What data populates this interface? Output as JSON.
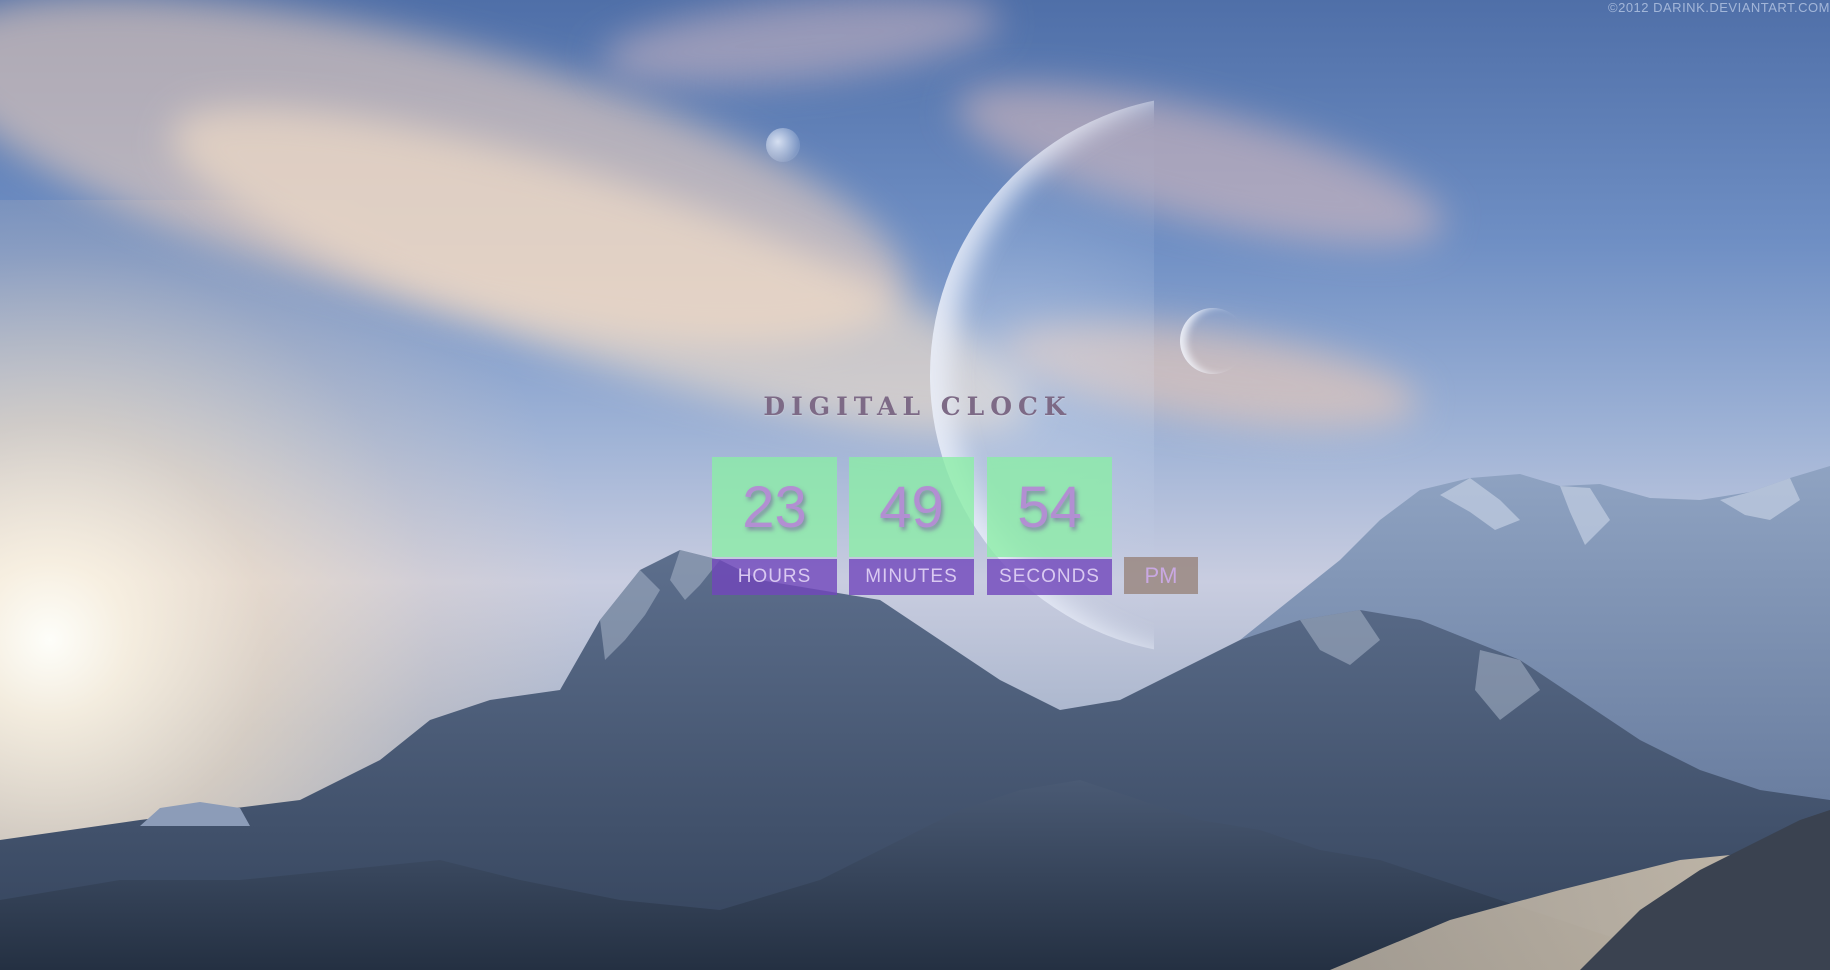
{
  "watermark": "©2012 DARINK.DEVIANTART.COM",
  "clock": {
    "title": "DIGITAL CLOCK",
    "hours": "23",
    "minutes": "49",
    "seconds": "54",
    "hours_label": "HOURS",
    "minutes_label": "MINUTES",
    "seconds_label": "SECONDS",
    "period": "PM"
  },
  "colors": {
    "digit_box": "#8aeea5",
    "digit_text": "#b28fd2",
    "label_box": "#7046bc",
    "label_text": "#d9c9f1",
    "title_text": "#7d6a86",
    "period_box": "#968278"
  }
}
